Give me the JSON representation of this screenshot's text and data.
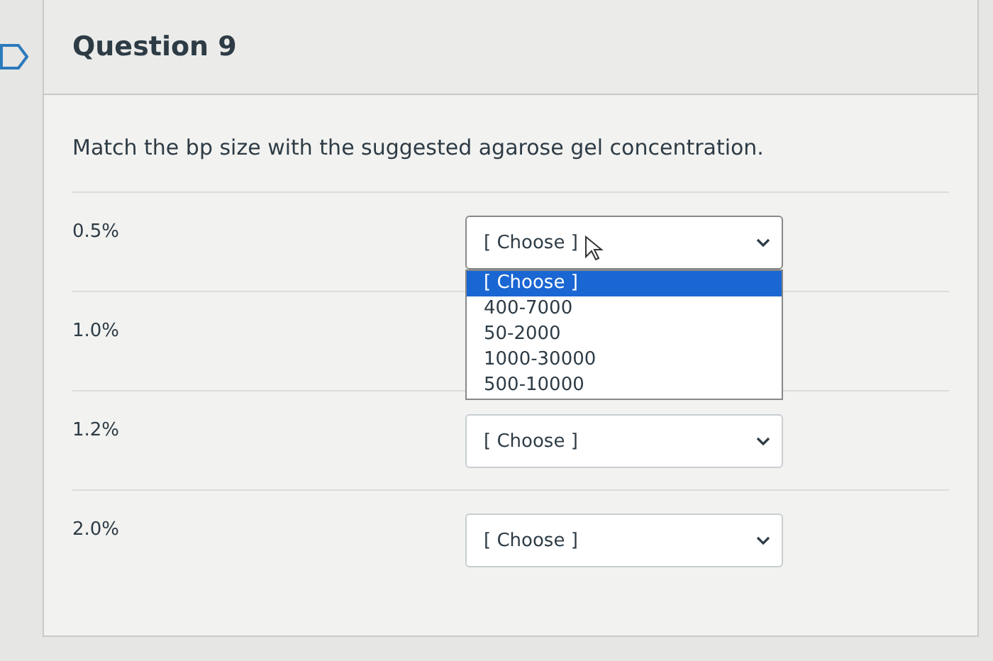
{
  "question": {
    "title": "Question 9",
    "prompt": "Match the bp size with the suggested agarose gel concentration."
  },
  "rows": [
    {
      "label": "0.5%",
      "value": "[ Choose ]",
      "expanded": true,
      "options": [
        {
          "label": "[ Choose ]",
          "selected": true
        },
        {
          "label": "400-7000",
          "selected": false
        },
        {
          "label": "50-2000",
          "selected": false
        },
        {
          "label": "1000-30000",
          "selected": false
        },
        {
          "label": "500-10000",
          "selected": false
        }
      ]
    },
    {
      "label": "1.0%"
    },
    {
      "label": "1.2%",
      "value": "[ Choose ]"
    },
    {
      "label": "2.0%",
      "value": "[ Choose ]"
    }
  ]
}
